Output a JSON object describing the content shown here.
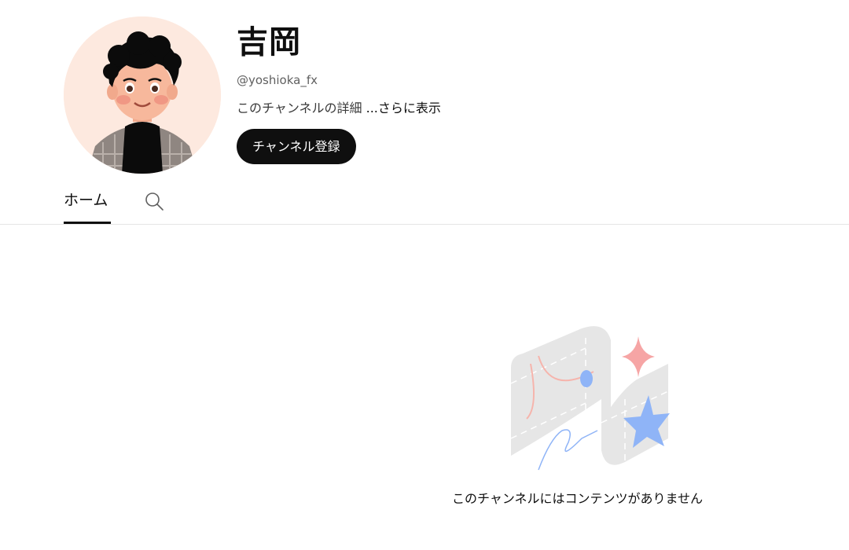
{
  "channel": {
    "name": "吉岡",
    "handle": "@yoshioka_fx",
    "description": "このチャンネルの詳細",
    "more_label": "...さらに表示",
    "subscribe_label": "チャンネル登録"
  },
  "tabs": {
    "home_label": "ホーム",
    "search_icon": "search-icon"
  },
  "empty_state": {
    "message": "このチャンネルにはコンテンツがありません"
  },
  "colors": {
    "button_bg": "#0f0f0f",
    "button_text": "#ffffff",
    "avatar_bg": "#fde9df",
    "accent_pink": "#f6a5a5",
    "accent_blue": "#8fb4f7"
  }
}
